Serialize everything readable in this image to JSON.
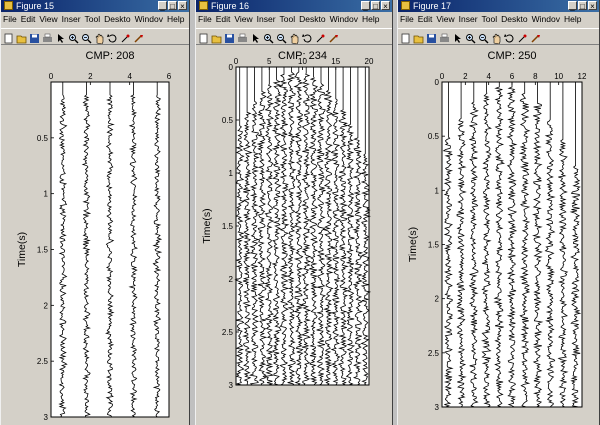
{
  "menu_items": [
    "File",
    "Edit",
    "View",
    "Inser",
    "Tool",
    "Deskto",
    "Windov",
    "Help"
  ],
  "tools": [
    "new-icon",
    "open-icon",
    "save-icon",
    "print-icon",
    "pointer-icon",
    "zoom-in-icon",
    "zoom-out-icon",
    "pan-icon",
    "rotate-icon",
    "data-cursor-icon",
    "brush-icon"
  ],
  "windows": [
    {
      "title": "Figure 15",
      "chart_data": {
        "type": "line",
        "title": "CMP: 208",
        "ylabel": "Time(s)",
        "xlabel": "",
        "xlim": [
          0,
          6
        ],
        "x_ticks": [
          "0",
          "2",
          "4",
          "6"
        ],
        "ylim": [
          3,
          0
        ],
        "y_ticks": [
          "0.5",
          "1",
          "1.5",
          "2",
          "2.5",
          "3"
        ],
        "traces": 5,
        "grid": false
      }
    },
    {
      "title": "Figure 16",
      "chart_data": {
        "type": "line",
        "title": "CMP: 234",
        "ylabel": "Time(s)",
        "xlabel": "",
        "xlim": [
          0,
          20
        ],
        "x_ticks": [
          "0",
          "5",
          "10",
          "15",
          "20"
        ],
        "ylim": [
          3,
          0
        ],
        "y_ticks": [
          "0",
          "0.5",
          "1",
          "1.5",
          "2",
          "2.5",
          "3"
        ],
        "traces": 18,
        "grid": false
      }
    },
    {
      "title": "Figure 17",
      "chart_data": {
        "type": "line",
        "title": "CMP: 250",
        "ylabel": "Time(s)",
        "xlabel": "",
        "xlim": [
          0,
          12
        ],
        "x_ticks": [
          "0",
          "2",
          "4",
          "6",
          "8",
          "10",
          "12"
        ],
        "ylim": [
          3,
          0
        ],
        "y_ticks": [
          "0",
          "0.5",
          "1",
          "1.5",
          "2",
          "2.5",
          "3"
        ],
        "traces": 11,
        "grid": false
      }
    }
  ]
}
